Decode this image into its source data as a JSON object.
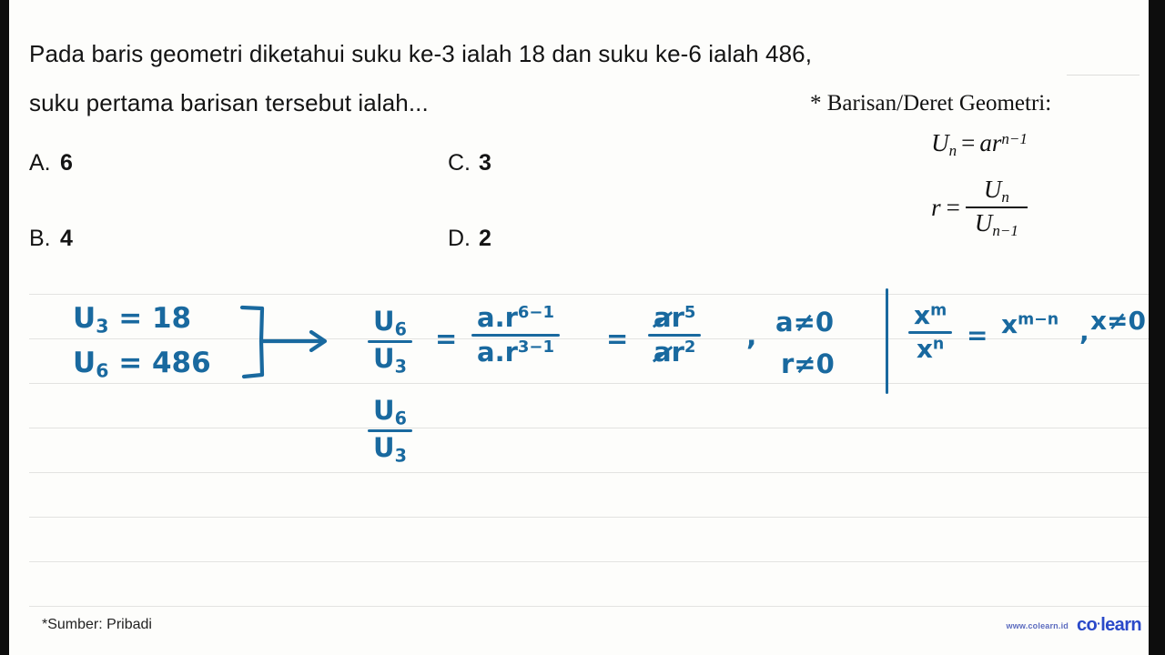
{
  "question": {
    "line1": "Pada baris geometri diketahui suku ke-3 ialah 18 dan suku ke-6 ialah 486,",
    "line2": "suku pertama barisan tersebut ialah..."
  },
  "options": [
    {
      "label": "A.",
      "value": "6"
    },
    {
      "label": "B.",
      "value": "4"
    },
    {
      "label": "C.",
      "value": "3"
    },
    {
      "label": "D.",
      "value": "2"
    }
  ],
  "formula_note": {
    "title": "* Barisan/Deret Geometri:",
    "eq_un": {
      "U": "U",
      "n_sub": "n",
      "eq": "=",
      "a": "a",
      "r": "r",
      "exp": "n−1"
    },
    "eq_r": {
      "r": "r",
      "eq": "=",
      "num_U": "U",
      "num_sub": "n",
      "den_U": "U",
      "den_sub": "n−1"
    }
  },
  "handwriting": {
    "given": {
      "u3_label": "U",
      "u3_sub": "3",
      "u3_eq": "= 18",
      "u6_label": "U",
      "u6_sub": "6",
      "u6_eq": "= 486"
    },
    "ratio_lhs": {
      "num_U": "U",
      "num_sub": "6",
      "den_U": "U",
      "den_sub": "3"
    },
    "eq1": "=",
    "expansion": {
      "num_a": "a",
      "num_dot": ".",
      "num_r": "r",
      "num_exp": "6−1",
      "den_a": "a",
      "den_dot": ".",
      "den_r": "r",
      "den_exp": "3−1"
    },
    "eq2": "=",
    "simplified": {
      "num_a": "a",
      "num_r": "r",
      "num_exp": "5",
      "den_a": "a",
      "den_r": "r",
      "den_exp": "2"
    },
    "comma": ",",
    "conditions": {
      "a": "a≠0",
      "r": "r≠0"
    },
    "power_rule": {
      "num_x": "x",
      "num_exp": "m",
      "den_x": "x",
      "den_exp": "n",
      "eq": "=",
      "result_x": "x",
      "result_exp": "m−n",
      "comma": ",",
      "cond": "x≠0"
    },
    "ratio_repeat": {
      "num_U": "U",
      "num_sub": "6",
      "den_U": "U",
      "den_sub": "3"
    }
  },
  "footer": {
    "source": "*Sumber: Pribadi",
    "brand_url": "www.colearn.id",
    "brand_name_part1": "co",
    "brand_dot": "·",
    "brand_name_part2": "learn"
  },
  "colors": {
    "ink_blue": "#19699f",
    "paper": "#fdfdfb",
    "rule_line": "#e3e3e1",
    "brand_blue": "#2a49c9",
    "text_black": "#141414"
  }
}
